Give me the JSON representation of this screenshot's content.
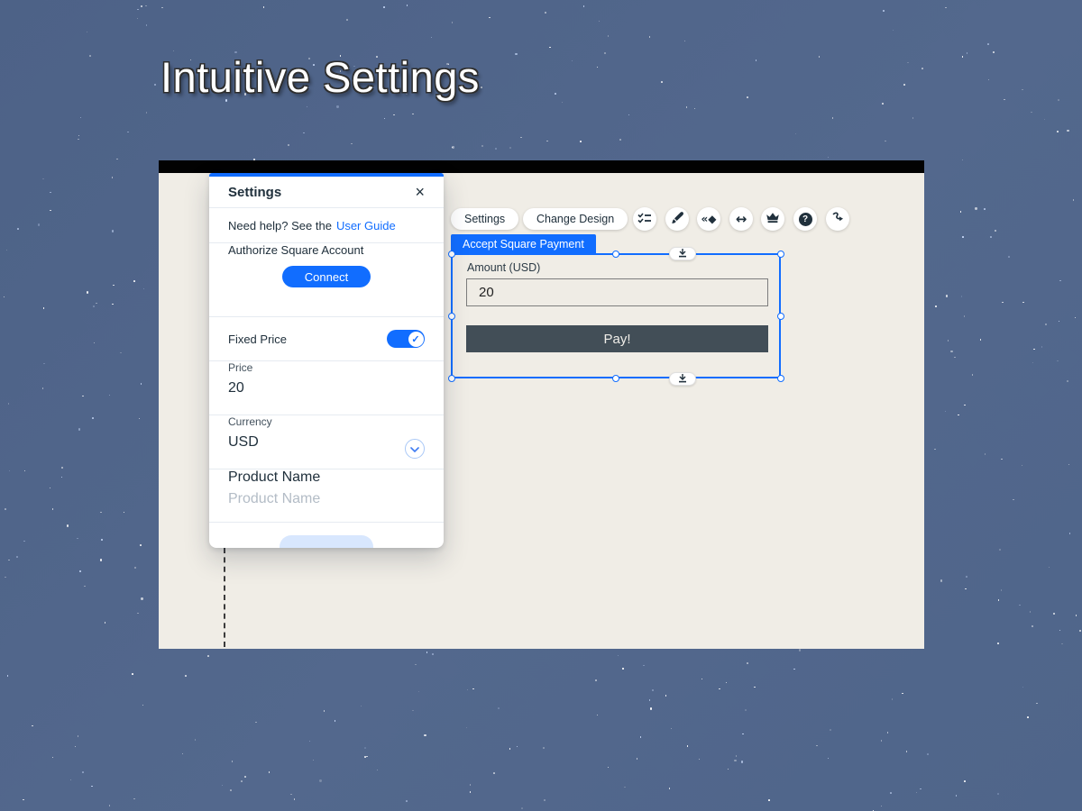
{
  "title": "Intuitive Settings",
  "panel": {
    "header": "Settings",
    "help_prefix": "Need help? See the",
    "help_link": "User Guide",
    "authorize_label": "Authorize Square Account",
    "connect_button": "Connect",
    "fixed_price_label": "Fixed Price",
    "price_label": "Price",
    "price_value": "20",
    "currency_label": "Currency",
    "currency_value": "USD",
    "product_name_label": "Product Name",
    "product_name_placeholder": "Product Name"
  },
  "toolbar": {
    "settings_button": "Settings",
    "change_design_button": "Change Design",
    "icon_names": [
      "checklist-icon",
      "paintbrush-icon",
      "animation-icon",
      "stretch-icon",
      "upgrade-crown-icon",
      "help-icon",
      "connector-icon"
    ]
  },
  "widget": {
    "tab_label": "Accept Square Payment",
    "amount_label": "Amount (USD)",
    "amount_value": "20",
    "pay_button": "Pay!"
  },
  "glyphs": {
    "close": "×",
    "animation": "«◆",
    "stretch": "↔",
    "help": "?",
    "toggle_check": "✓"
  },
  "colors": {
    "accent_blue": "#116dff",
    "selection_blue": "#116dff",
    "pay_button_bg": "#424e57",
    "canvas_bg": "#f0ede6",
    "backdrop_blue": "#51668b",
    "topbar_black": "#020202",
    "link_blue": "#116dff",
    "placeholder_gray": "#b3bcc6"
  }
}
